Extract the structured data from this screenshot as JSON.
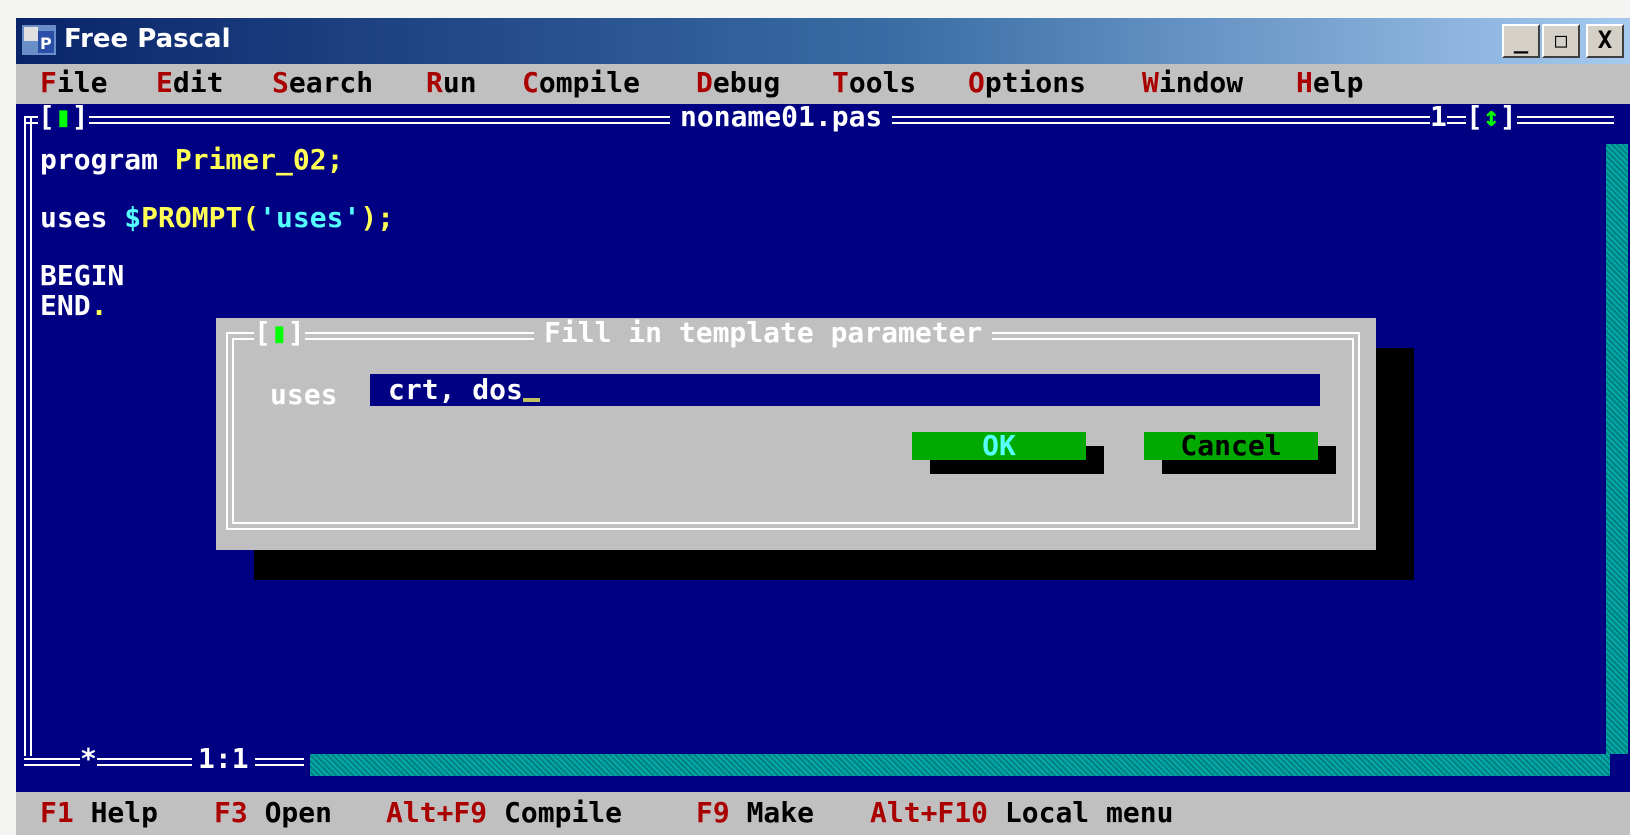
{
  "window": {
    "title": "Free Pascal",
    "minimize": "_",
    "maximize": "□",
    "close": "X"
  },
  "menu": [
    {
      "hot": "F",
      "rest": "ile"
    },
    {
      "hot": "E",
      "rest": "dit"
    },
    {
      "hot": "S",
      "rest": "earch"
    },
    {
      "hot": "R",
      "rest": "un"
    },
    {
      "hot": "C",
      "rest": "ompile"
    },
    {
      "hot": "D",
      "rest": "ebug"
    },
    {
      "hot": "T",
      "rest": "ools"
    },
    {
      "hot": "O",
      "rest": "ptions"
    },
    {
      "hot": "W",
      "rest": "indow"
    },
    {
      "hot": "H",
      "rest": "elp"
    }
  ],
  "editor": {
    "close_box": "[▮]",
    "filename": "noname01.pas",
    "window_number": "1",
    "zoom_box": "[↕]",
    "lines": {
      "l1_kw": "program ",
      "l1_id": "Primer_02;",
      "l3_kw": "uses ",
      "l3_dollar": "$",
      "l3_fn": "PROMPT(",
      "l3_str": "'uses'",
      "l3_end": ");",
      "l5": "BEGIN",
      "l6_a": "END",
      "l6_b": "."
    },
    "modified_marker": "*",
    "cursor_pos": "1:1"
  },
  "dialog": {
    "close_box": "[▮]",
    "title": "Fill in template parameter",
    "field_label": "uses",
    "field_value": "crt, dos",
    "ok_label": "OK",
    "cancel_label": "Cancel"
  },
  "status": [
    {
      "key": "F1",
      "label": "Help"
    },
    {
      "key": "F3",
      "label": "Open"
    },
    {
      "key": "Alt+F9",
      "label": "Compile"
    },
    {
      "key": "F9",
      "label": "Make"
    },
    {
      "key": "Alt+F10",
      "label": "Local menu"
    }
  ],
  "colors": {
    "desktop_blue": "#000082",
    "hotkey_red": "#aa0000",
    "button_green": "#00aa00",
    "identifier_yellow": "#ffff55",
    "string_cyan": "#55ffff"
  }
}
